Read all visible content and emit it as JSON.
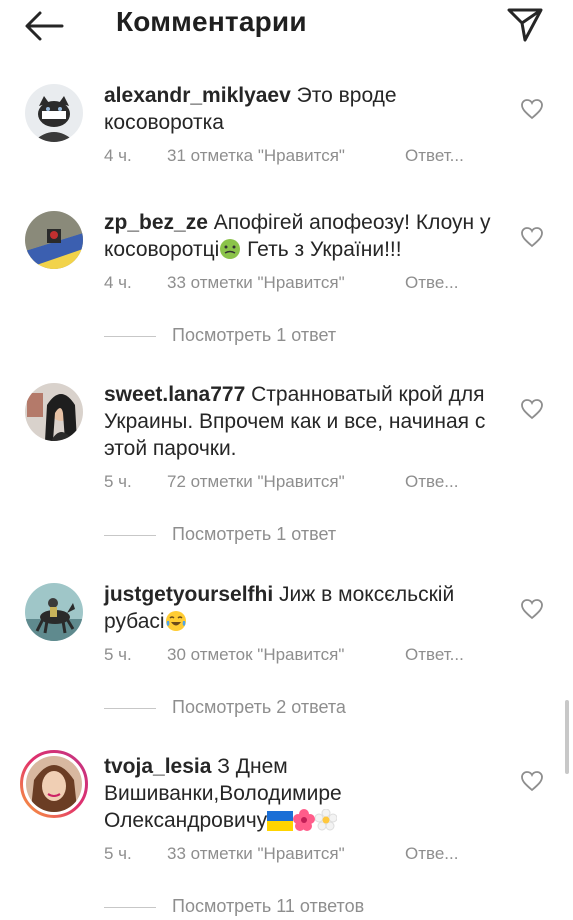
{
  "header": {
    "title": "Комментарии"
  },
  "comments": [
    {
      "username": "alexandr_miklyaev",
      "text": "Это вроде косоворотка",
      "time": "4 ч.",
      "likes": "31 отметка \"Нравится\"",
      "reply": "Ответ..."
    },
    {
      "username": "zp_bez_ze",
      "text": "Апофігей апофеозу! Клоун у косоворотці",
      "text_after": " Геть з України!!!",
      "time": "4 ч.",
      "likes": "33 отметки \"Нравится\"",
      "reply": "Отве..."
    },
    {
      "username": "sweet.lana777",
      "text": "Странноватый крой для Украины. Впрочем как и все, начиная с этой парочки.",
      "time": "5 ч.",
      "likes": "72 отметки \"Нравится\"",
      "reply": "Отве..."
    },
    {
      "username": "justgetyourselfhi",
      "text": "Јиж в моксєльскій рубасі",
      "time": "5 ч.",
      "likes": "30 отметок \"Нравится\"",
      "reply": "Ответ..."
    },
    {
      "username": "tvoja_lesia",
      "text": "З Днем Вишиванки,Володимире Олександровичу",
      "time": "5 ч.",
      "likes": "33 отметки \"Нравится\"",
      "reply": "Отве..."
    }
  ],
  "view_replies": [
    "Посмотреть 1 ответ",
    "Посмотреть 1 ответ",
    "Посмотреть 2 ответа",
    "Посмотреть 11 ответов"
  ],
  "icons": {
    "back": "arrow-left-icon",
    "send": "paper-plane-icon",
    "like": "heart-outline-icon"
  },
  "colors": {
    "text": "#262626",
    "meta": "#8e8e8e",
    "story_ring": "#c13584"
  }
}
